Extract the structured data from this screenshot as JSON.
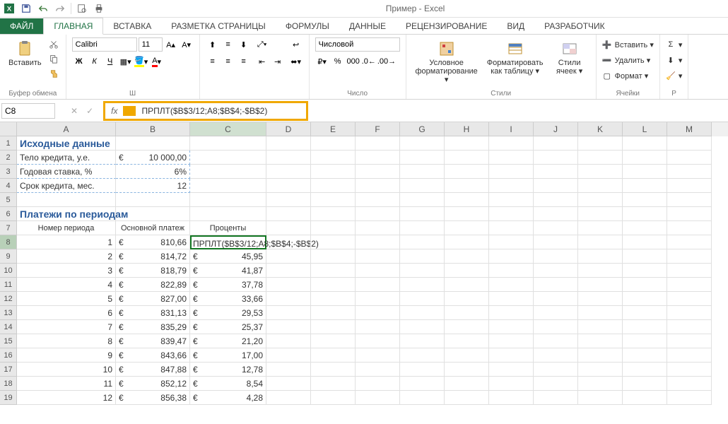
{
  "app_title": "Пример - Excel",
  "tabs": {
    "file": "ФАЙЛ",
    "home": "ГЛАВНАЯ",
    "insert": "ВСТАВКА",
    "layout": "РАЗМЕТКА СТРАНИЦЫ",
    "formulas": "ФОРМУЛЫ",
    "data": "ДАННЫЕ",
    "review": "РЕЦЕНЗИРОВАНИЕ",
    "view": "ВИД",
    "developer": "РАЗРАБОТЧИК"
  },
  "ribbon": {
    "clipboard": {
      "paste": "Вставить",
      "label": "Буфер обмена"
    },
    "font": {
      "name": "Calibri",
      "size": "11",
      "label": "Ш"
    },
    "number": {
      "format": "Числовой",
      "label": "Число"
    },
    "styles": {
      "cond": "Условное форматирование ▾",
      "table": "Форматировать как таблицу ▾",
      "cells": "Стили ячеек ▾",
      "label": "Стили"
    },
    "cells": {
      "insert": "Вставить ▾",
      "delete": "Удалить ▾",
      "format": "Формат ▾",
      "label": "Ячейки"
    },
    "editing": {
      "label": "Р"
    }
  },
  "namebox": "C8",
  "formula": "ПРПЛТ($B$3/12;A8;$B$4;-$B$2)",
  "cols": [
    "A",
    "B",
    "C",
    "D",
    "E",
    "F",
    "G",
    "H",
    "I",
    "J",
    "K",
    "L",
    "M"
  ],
  "sheet": {
    "r1": {
      "a": "Исходные данные"
    },
    "r2": {
      "a": "Тело кредита, y.e.",
      "b_cur": "€",
      "b_val": "10 000,00"
    },
    "r3": {
      "a": "Годовая ставка, %",
      "b": "6%"
    },
    "r4": {
      "a": "Срок кредита, мес.",
      "b": "12"
    },
    "r6": {
      "a": "Платежи по периодам"
    },
    "r7": {
      "a": "Номер периода",
      "b": "Основной платеж",
      "c": "Проценты"
    },
    "rows": [
      {
        "n": "1",
        "bc": "€",
        "bv": "810,66",
        "c": "ПРПЛТ($B$3/12;A8;$B$4;-$B$2)"
      },
      {
        "n": "2",
        "bc": "€",
        "bv": "814,72",
        "cc": "€",
        "cv": "45,95"
      },
      {
        "n": "3",
        "bc": "€",
        "bv": "818,79",
        "cc": "€",
        "cv": "41,87"
      },
      {
        "n": "4",
        "bc": "€",
        "bv": "822,89",
        "cc": "€",
        "cv": "37,78"
      },
      {
        "n": "5",
        "bc": "€",
        "bv": "827,00",
        "cc": "€",
        "cv": "33,66"
      },
      {
        "n": "6",
        "bc": "€",
        "bv": "831,13",
        "cc": "€",
        "cv": "29,53"
      },
      {
        "n": "7",
        "bc": "€",
        "bv": "835,29",
        "cc": "€",
        "cv": "25,37"
      },
      {
        "n": "8",
        "bc": "€",
        "bv": "839,47",
        "cc": "€",
        "cv": "21,20"
      },
      {
        "n": "9",
        "bc": "€",
        "bv": "843,66",
        "cc": "€",
        "cv": "17,00"
      },
      {
        "n": "10",
        "bc": "€",
        "bv": "847,88",
        "cc": "€",
        "cv": "12,78"
      },
      {
        "n": "11",
        "bc": "€",
        "bv": "852,12",
        "cc": "€",
        "cv": "8,54"
      },
      {
        "n": "12",
        "bc": "€",
        "bv": "856,38",
        "cc": "€",
        "cv": "4,28"
      }
    ]
  }
}
